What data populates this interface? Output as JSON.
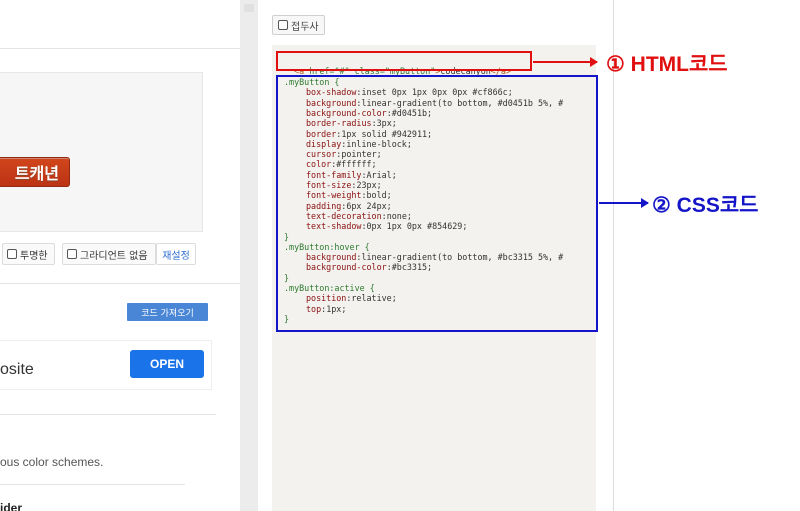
{
  "left": {
    "preview_button_label": "트캐년",
    "options": {
      "transparent_label": "투명한",
      "no_gradient_label": "그라디언트 없음",
      "reset_label": "재설정"
    },
    "get_code_label": "코드 가져오기",
    "ad": {
      "text": "osite",
      "open_label": "OPEN"
    },
    "scheme_text": "ous color schemes.",
    "slider_text": "ider"
  },
  "right": {
    "collapse_label": "접두사",
    "html_code": {
      "tag_open": "<a ",
      "attr_href": "href=\"#\" ",
      "attr_class": "class=\"myButton\"",
      "gt": ">",
      "text": "codecanyon",
      "tag_close": "</a>"
    },
    "css_code": [
      {
        "t": "sel",
        "text": ".myButton {"
      },
      {
        "t": "prop",
        "k": "box-shadow",
        "v": "inset 0px 1px 0px 0px #cf866c;"
      },
      {
        "t": "prop",
        "k": "background",
        "v": "linear-gradient(to bottom, #d0451b 5%, #"
      },
      {
        "t": "prop",
        "k": "background-color",
        "v": "#d0451b;"
      },
      {
        "t": "prop",
        "k": "border-radius",
        "v": "3px;"
      },
      {
        "t": "prop",
        "k": "border",
        "v": "1px solid #942911;"
      },
      {
        "t": "prop",
        "k": "display",
        "v": "inline-block;"
      },
      {
        "t": "prop",
        "k": "cursor",
        "v": "pointer;"
      },
      {
        "t": "prop",
        "k": "color",
        "v": "#ffffff;"
      },
      {
        "t": "prop",
        "k": "font-family",
        "v": "Arial;"
      },
      {
        "t": "prop",
        "k": "font-size",
        "v": "23px;"
      },
      {
        "t": "prop",
        "k": "font-weight",
        "v": "bold;"
      },
      {
        "t": "prop",
        "k": "padding",
        "v": "6px 24px;"
      },
      {
        "t": "prop",
        "k": "text-decoration",
        "v": "none;"
      },
      {
        "t": "prop",
        "k": "text-shadow",
        "v": "0px 1px 0px #854629;"
      },
      {
        "t": "sel",
        "text": "}"
      },
      {
        "t": "sel",
        "text": ".myButton:hover {"
      },
      {
        "t": "prop",
        "k": "background",
        "v": "linear-gradient(to bottom, #bc3315 5%, #"
      },
      {
        "t": "prop",
        "k": "background-color",
        "v": "#bc3315;"
      },
      {
        "t": "sel",
        "text": "}"
      },
      {
        "t": "sel",
        "text": ".myButton:active {"
      },
      {
        "t": "prop",
        "k": "position",
        "v": "relative;"
      },
      {
        "t": "prop",
        "k": "top",
        "v": "1px;"
      },
      {
        "t": "sel",
        "text": "}"
      }
    ]
  },
  "annotations": {
    "html_label": "① HTML코드",
    "css_label": "② CSS코드",
    "html_color": "#e01010",
    "css_color": "#1414c8"
  },
  "colors": {
    "button_bg": "#d0451b",
    "open_button": "#1a73e8",
    "get_code_button": "#4a86d6"
  }
}
